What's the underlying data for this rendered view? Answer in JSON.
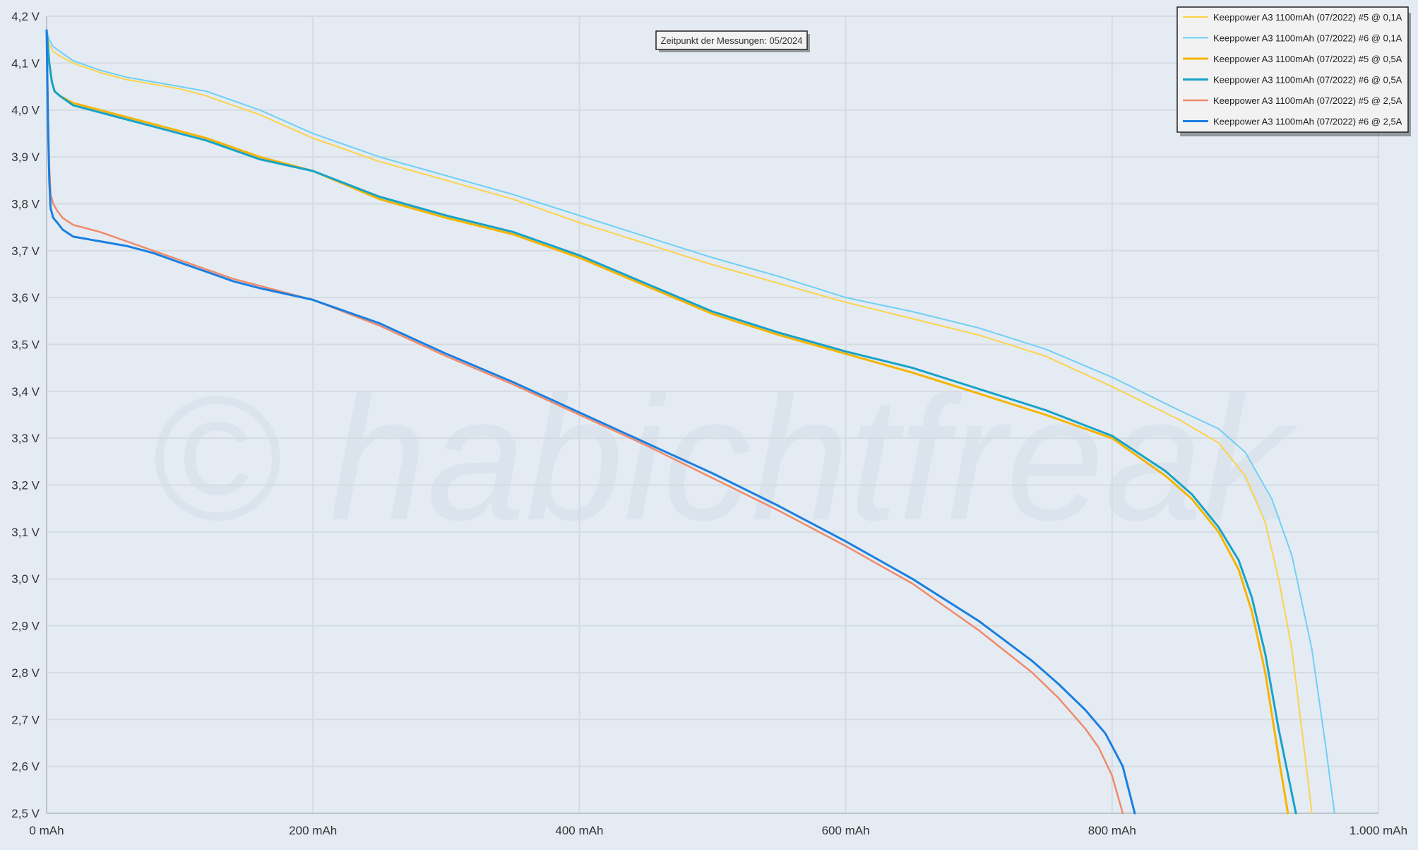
{
  "watermark": "© habichtfreak",
  "annotation": "Zeitpunkt der Messungen: 05/2024",
  "chart_data": {
    "type": "line",
    "title": "",
    "xlabel": "",
    "ylabel": "",
    "xlim": [
      0,
      1000
    ],
    "ylim": [
      2.5,
      4.2
    ],
    "grid": true,
    "legend_position": "top-right",
    "x_ticks": [
      0,
      200,
      400,
      600,
      800,
      1000
    ],
    "x_tick_labels": [
      "0 mAh",
      "200 mAh",
      "400 mAh",
      "600 mAh",
      "800 mAh",
      "1.000 mAh"
    ],
    "y_ticks": [
      2.5,
      2.6,
      2.7,
      2.8,
      2.9,
      3.0,
      3.1,
      3.2,
      3.3,
      3.4,
      3.5,
      3.6,
      3.7,
      3.8,
      3.9,
      4.0,
      4.1,
      4.2
    ],
    "y_tick_labels": [
      "2,5 V",
      "2,6 V",
      "2,7 V",
      "2,8 V",
      "2,9 V",
      "3,0 V",
      "3,1 V",
      "3,2 V",
      "3,3 V",
      "3,4 V",
      "3,5 V",
      "3,6 V",
      "3,7 V",
      "3,8 V",
      "3,9 V",
      "4,0 V",
      "4,1 V",
      "4,2 V"
    ],
    "series": [
      {
        "name": "Keeppower A3 1100mAh (07/2022) #5 @ 0,1A",
        "color": "#fcd34a",
        "width": 2,
        "x": [
          0,
          2,
          5,
          10,
          20,
          40,
          60,
          80,
          100,
          120,
          140,
          160,
          180,
          200,
          250,
          300,
          350,
          400,
          450,
          500,
          550,
          600,
          650,
          700,
          750,
          800,
          850,
          880,
          900,
          915,
          925,
          935,
          945,
          950
        ],
        "y": [
          4.17,
          4.14,
          4.125,
          4.115,
          4.1,
          4.08,
          4.065,
          4.055,
          4.045,
          4.03,
          4.01,
          3.99,
          3.965,
          3.94,
          3.89,
          3.85,
          3.81,
          3.76,
          3.715,
          3.67,
          3.63,
          3.59,
          3.555,
          3.52,
          3.475,
          3.41,
          3.34,
          3.29,
          3.22,
          3.12,
          3.0,
          2.85,
          2.62,
          2.5
        ]
      },
      {
        "name": "Keeppower A3 1100mAh (07/2022) #6 @ 0,1A",
        "color": "#6fd0f5",
        "width": 2,
        "x": [
          0,
          2,
          5,
          10,
          20,
          40,
          60,
          80,
          100,
          120,
          140,
          160,
          180,
          200,
          250,
          300,
          350,
          400,
          450,
          500,
          550,
          600,
          650,
          700,
          750,
          800,
          850,
          880,
          900,
          920,
          935,
          950,
          960,
          967
        ],
        "y": [
          4.17,
          4.15,
          4.135,
          4.125,
          4.105,
          4.085,
          4.07,
          4.06,
          4.05,
          4.04,
          4.02,
          4.0,
          3.975,
          3.95,
          3.9,
          3.86,
          3.82,
          3.775,
          3.73,
          3.685,
          3.645,
          3.6,
          3.57,
          3.535,
          3.49,
          3.43,
          3.36,
          3.32,
          3.27,
          3.17,
          3.05,
          2.85,
          2.65,
          2.5
        ]
      },
      {
        "name": "Keeppower A3 1100mAh (07/2022) #5 @ 0,5A",
        "color": "#f5b400",
        "width": 3,
        "x": [
          0,
          2,
          4,
          6,
          10,
          20,
          40,
          60,
          80,
          100,
          120,
          140,
          160,
          200,
          250,
          300,
          350,
          400,
          450,
          500,
          550,
          600,
          650,
          700,
          750,
          800,
          840,
          860,
          880,
          895,
          905,
          915,
          925,
          932
        ],
        "y": [
          4.17,
          4.1,
          4.06,
          4.04,
          4.03,
          4.015,
          4.0,
          3.985,
          3.97,
          3.955,
          3.94,
          3.92,
          3.9,
          3.87,
          3.81,
          3.77,
          3.735,
          3.685,
          3.625,
          3.565,
          3.52,
          3.48,
          3.44,
          3.395,
          3.35,
          3.3,
          3.22,
          3.17,
          3.1,
          3.02,
          2.93,
          2.8,
          2.62,
          2.5
        ]
      },
      {
        "name": "Keeppower A3 1100mAh (07/2022) #6 @ 0,5A",
        "color": "#17a2c8",
        "width": 3,
        "x": [
          0,
          2,
          4,
          6,
          10,
          20,
          40,
          60,
          80,
          100,
          120,
          140,
          160,
          200,
          250,
          300,
          350,
          400,
          450,
          500,
          550,
          600,
          650,
          700,
          750,
          800,
          840,
          860,
          880,
          895,
          905,
          915,
          925,
          938
        ],
        "y": [
          4.17,
          4.1,
          4.06,
          4.04,
          4.03,
          4.01,
          3.995,
          3.98,
          3.965,
          3.95,
          3.935,
          3.915,
          3.895,
          3.87,
          3.815,
          3.775,
          3.74,
          3.69,
          3.63,
          3.57,
          3.525,
          3.485,
          3.45,
          3.405,
          3.36,
          3.305,
          3.23,
          3.18,
          3.11,
          3.04,
          2.96,
          2.84,
          2.68,
          2.5
        ]
      },
      {
        "name": "Keeppower A3 1100mAh (07/2022) #5 @ 2,5A",
        "color": "#f08a6a",
        "width": 2.5,
        "x": [
          0,
          1,
          2,
          3,
          5,
          8,
          12,
          20,
          40,
          60,
          80,
          100,
          120,
          140,
          160,
          200,
          250,
          300,
          350,
          400,
          450,
          500,
          550,
          600,
          650,
          700,
          740,
          760,
          780,
          790,
          800,
          808
        ],
        "y": [
          4.17,
          4.0,
          3.88,
          3.82,
          3.8,
          3.785,
          3.77,
          3.755,
          3.74,
          3.72,
          3.7,
          3.68,
          3.66,
          3.64,
          3.625,
          3.595,
          3.54,
          3.475,
          3.415,
          3.35,
          3.285,
          3.215,
          3.145,
          3.07,
          2.99,
          2.89,
          2.8,
          2.745,
          2.68,
          2.64,
          2.58,
          2.5
        ]
      },
      {
        "name": "Keeppower A3 1100mAh (07/2022) #6 @ 2,5A",
        "color": "#1a7fe0",
        "width": 3,
        "x": [
          0,
          1,
          2,
          3,
          5,
          8,
          12,
          20,
          40,
          60,
          80,
          100,
          120,
          140,
          160,
          200,
          250,
          300,
          350,
          400,
          450,
          500,
          550,
          600,
          650,
          700,
          740,
          760,
          780,
          795,
          808,
          817
        ],
        "y": [
          4.17,
          3.98,
          3.85,
          3.79,
          3.77,
          3.76,
          3.745,
          3.73,
          3.72,
          3.71,
          3.695,
          3.675,
          3.655,
          3.635,
          3.62,
          3.595,
          3.545,
          3.48,
          3.42,
          3.355,
          3.29,
          3.225,
          3.155,
          3.08,
          3.0,
          2.91,
          2.825,
          2.775,
          2.72,
          2.67,
          2.6,
          2.5
        ]
      }
    ]
  }
}
